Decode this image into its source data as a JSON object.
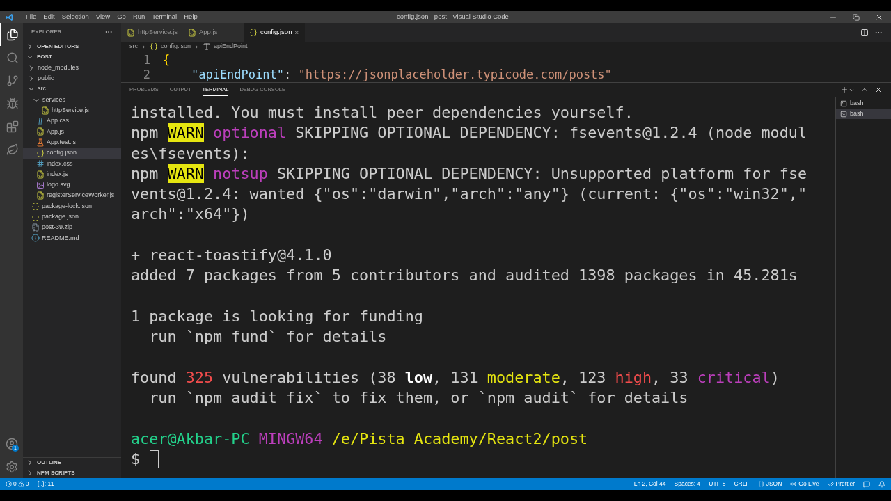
{
  "menu": [
    "File",
    "Edit",
    "Selection",
    "View",
    "Go",
    "Run",
    "Terminal",
    "Help"
  ],
  "window": {
    "title": "config.json - post - Visual Studio Code"
  },
  "activity_bar": [
    {
      "kind": "files",
      "selected": true
    },
    {
      "kind": "search",
      "selected": false
    },
    {
      "kind": "source-control",
      "selected": false
    },
    {
      "kind": "debug",
      "selected": false
    },
    {
      "kind": "extensions",
      "selected": false
    },
    {
      "kind": "leaf",
      "selected": false
    }
  ],
  "account_badge": "1",
  "sidebar": {
    "title": "EXPLORER",
    "sections": [
      {
        "label": "OPEN EDITORS",
        "expanded": false
      },
      {
        "label": "POST",
        "expanded": true
      }
    ],
    "items": [
      {
        "label": "node_modules",
        "kind": "folder",
        "expanded": false
      },
      {
        "label": "public",
        "kind": "folder",
        "expanded": false
      },
      {
        "label": "src",
        "kind": "folder",
        "expanded": true,
        "children": [
          {
            "label": "services",
            "kind": "folder",
            "expanded": true,
            "children": [
              {
                "label": "httpService.js",
                "kind": "js",
                "selected": false
              }
            ]
          },
          {
            "label": "App.css",
            "kind": "css",
            "selected": false
          },
          {
            "label": "App.js",
            "kind": "js",
            "selected": false
          },
          {
            "label": "App.test.js",
            "kind": "test",
            "selected": false
          },
          {
            "label": "config.json",
            "kind": "json",
            "selected": true
          },
          {
            "label": "index.css",
            "kind": "css",
            "selected": false
          },
          {
            "label": "index.js",
            "kind": "js",
            "selected": false
          },
          {
            "label": "logo.svg",
            "kind": "svg",
            "selected": false
          },
          {
            "label": "registerServiceWorker.js",
            "kind": "js",
            "selected": false
          }
        ]
      },
      {
        "label": "package-lock.json",
        "kind": "json",
        "selected": false
      },
      {
        "label": "package.json",
        "kind": "json",
        "selected": false
      },
      {
        "label": "post-39.zip",
        "kind": "zip",
        "selected": false
      },
      {
        "label": "README.md",
        "kind": "md",
        "selected": false
      }
    ],
    "bottom_sections": [
      {
        "label": "OUTLINE",
        "expanded": false
      },
      {
        "label": "NPM SCRIPTS",
        "expanded": false
      }
    ]
  },
  "tabs": [
    {
      "label": "httpService.js",
      "kind": "js",
      "selected": false
    },
    {
      "label": "App.js",
      "kind": "js",
      "selected": false
    },
    {
      "label": "config.json",
      "kind": "json",
      "selected": true
    }
  ],
  "breadcrumb": [
    {
      "label": "src",
      "kind": "folder"
    },
    {
      "label": "config.json",
      "kind": "json"
    },
    {
      "label": "apiEndPoint",
      "kind": "string"
    }
  ],
  "editor": {
    "lines": [
      {
        "number": "1",
        "tokens": [
          {
            "kind": "bracket",
            "text": "{"
          }
        ]
      },
      {
        "number": "2",
        "tokens": [
          {
            "kind": "key",
            "text": "    \"apiEndPoint\""
          },
          {
            "kind": "punct",
            "text": ": "
          },
          {
            "kind": "string",
            "text": "\"https://jsonplaceholder.typicode.com/posts\""
          }
        ]
      }
    ]
  },
  "panel_tabs": [
    {
      "label": "PROBLEMS",
      "selected": false
    },
    {
      "label": "OUTPUT",
      "selected": false
    },
    {
      "label": "TERMINAL",
      "selected": true
    },
    {
      "label": "DEBUG CONSOLE",
      "selected": false
    }
  ],
  "terminals": [
    {
      "label": "bash",
      "selected": false
    },
    {
      "label": "bash",
      "selected": true
    }
  ],
  "terminal": {
    "blocks": [
      [
        [
          {
            "kind": "plain",
            "text": "installed. You must install peer dependencies yourself."
          }
        ],
        [
          {
            "kind": "plain",
            "text": "npm "
          },
          {
            "kind": "warn",
            "text": "WARN"
          },
          {
            "kind": "magenta",
            "text": " optional"
          },
          {
            "kind": "plain",
            "text": " SKIPPING OPTIONAL DEPENDENCY: fsevents@1.2.4 (node_modul"
          }
        ],
        [
          {
            "kind": "plain",
            "text": "es\\fsevents):"
          }
        ],
        [
          {
            "kind": "plain",
            "text": "npm "
          },
          {
            "kind": "warn",
            "text": "WARN"
          },
          {
            "kind": "magenta",
            "text": " notsup"
          },
          {
            "kind": "plain",
            "text": " SKIPPING OPTIONAL DEPENDENCY: Unsupported platform for fse"
          }
        ],
        [
          {
            "kind": "plain",
            "text": "vents@1.2.4: wanted {\"os\":\"darwin\",\"arch\":\"any\"} (current: {\"os\":\"win32\",\""
          }
        ],
        [
          {
            "kind": "plain",
            "text": "arch\":\"x64\"})"
          }
        ]
      ],
      [
        [
          {
            "kind": "plain",
            "text": "+ react-toastify@4.1.0"
          }
        ],
        [
          {
            "kind": "plain",
            "text": "added 7 packages from 5 contributors and audited 1398 packages in 45.281s"
          }
        ]
      ],
      [
        [
          {
            "kind": "plain",
            "text": "1 package is looking for funding"
          }
        ],
        [
          {
            "kind": "plain",
            "text": "  run `npm fund` for details"
          }
        ]
      ],
      [
        [
          {
            "kind": "plain",
            "text": "found "
          },
          {
            "kind": "red",
            "text": "325"
          },
          {
            "kind": "plain",
            "text": " vulnerabilities (38 "
          },
          {
            "kind": "bold",
            "text": "low"
          },
          {
            "kind": "plain",
            "text": ", 131 "
          },
          {
            "kind": "yellow",
            "text": "moderate"
          },
          {
            "kind": "plain",
            "text": ", 123 "
          },
          {
            "kind": "red",
            "text": "high"
          },
          {
            "kind": "plain",
            "text": ", 33 "
          },
          {
            "kind": "magenta",
            "text": "critical"
          },
          {
            "kind": "plain",
            "text": ")"
          }
        ],
        [
          {
            "kind": "plain",
            "text": "  run `npm audit fix` to fix them, or `npm audit` for details"
          }
        ]
      ],
      [
        [
          {
            "kind": "green",
            "text": "acer@Akbar-PC"
          },
          {
            "kind": "magenta",
            "text": " MINGW64"
          },
          {
            "kind": "yellow",
            "text": " /e/Pista Academy/React2/post"
          }
        ],
        [
          {
            "kind": "plain",
            "text": "$"
          }
        ]
      ]
    ]
  },
  "status_bar": {
    "errors": "0",
    "warnings": "0",
    "json_path": "{..}: 11",
    "right": [
      {
        "kind": "text",
        "label": "Ln 2, Col 44"
      },
      {
        "kind": "text",
        "label": "Spaces: 4"
      },
      {
        "kind": "text",
        "label": "UTF-8"
      },
      {
        "kind": "text",
        "label": "CRLF"
      },
      {
        "kind": "json",
        "label": "JSON"
      },
      {
        "kind": "live",
        "label": "Go Live"
      },
      {
        "kind": "prettier",
        "label": "Prettier"
      },
      {
        "kind": "feedback"
      },
      {
        "kind": "bell"
      }
    ]
  }
}
